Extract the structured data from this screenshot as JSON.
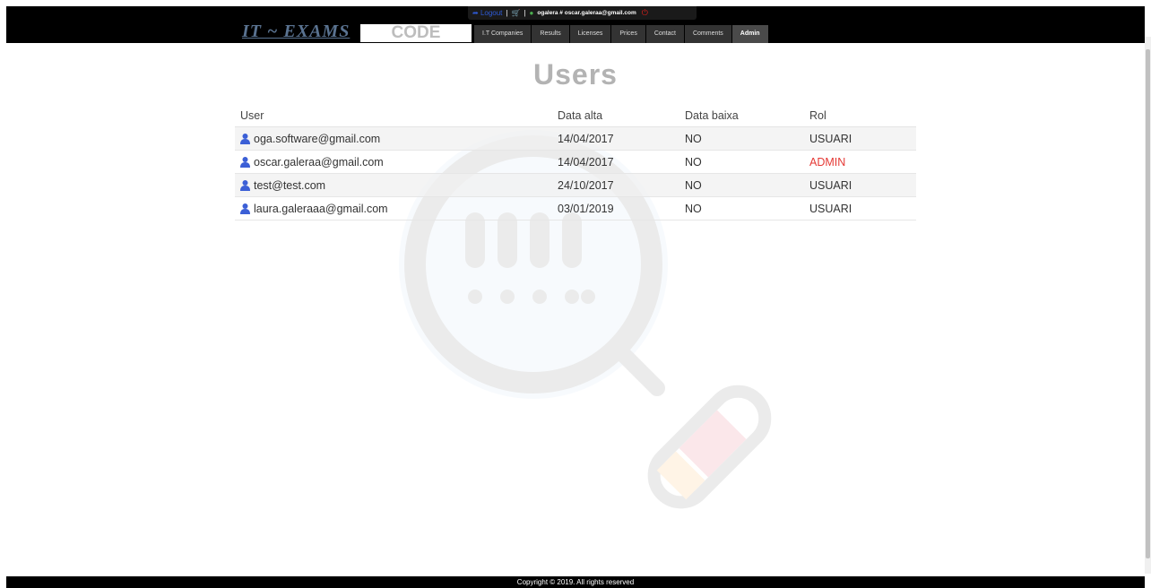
{
  "header": {
    "logout_label": "Logout",
    "user_label": "ogalera # oscar.galeraa@gmail.com",
    "logo_text": "IT ~ EXAMS",
    "code_label": "CODE",
    "nav": [
      {
        "label": "I.T Companies"
      },
      {
        "label": "Results"
      },
      {
        "label": "Licenses"
      },
      {
        "label": "Prices"
      },
      {
        "label": "Contact"
      },
      {
        "label": "Comments"
      },
      {
        "label": "Admin"
      }
    ]
  },
  "page": {
    "title": "Users"
  },
  "table": {
    "headers": [
      "User",
      "Data alta",
      "Data baixa",
      "Rol"
    ],
    "rows": [
      {
        "user": "oga.software@gmail.com",
        "data_alta": "14/04/2017",
        "data_baixa": "NO",
        "rol": "USUARI"
      },
      {
        "user": "oscar.galeraa@gmail.com",
        "data_alta": "14/04/2017",
        "data_baixa": "NO",
        "rol": "ADMIN"
      },
      {
        "user": "test@test.com",
        "data_alta": "24/10/2017",
        "data_baixa": "NO",
        "rol": "USUARI"
      },
      {
        "user": "laura.galeraaa@gmail.com",
        "data_alta": "03/01/2019",
        "data_baixa": "NO",
        "rol": "USUARI"
      }
    ]
  },
  "footer": {
    "copyright": "Copyright © 2019. All rights reserved"
  },
  "colors": {
    "admin_role": "#e53935",
    "user_icon": "#3b5fd6",
    "title": "#b3b3b3"
  },
  "icons": [
    "logout-icon",
    "cart-icon",
    "user-icon",
    "power-icon",
    "magnifier-watermark-icon"
  ]
}
